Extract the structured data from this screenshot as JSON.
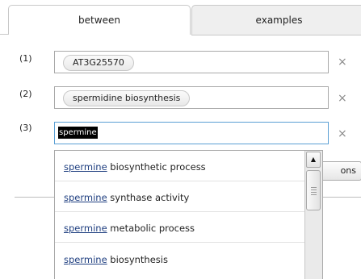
{
  "tabs": [
    {
      "label": "between"
    },
    {
      "label": "examples"
    }
  ],
  "rows": [
    {
      "number": "(1)",
      "chip": "AT3G25570"
    },
    {
      "number": "(2)",
      "chip": "spermidine biosynthesis"
    },
    {
      "number": "(3)",
      "value": "spermine"
    }
  ],
  "clear_glyph": "×",
  "options_button": {
    "label": "ons"
  },
  "dropdown": {
    "items": [
      {
        "match": "spermine",
        "rest": " biosynthetic process"
      },
      {
        "match": "spermine",
        "rest": " synthase activity"
      },
      {
        "match": "spermine",
        "rest": " metabolic process"
      },
      {
        "match": "spermine",
        "rest": " biosynthesis"
      }
    ],
    "scroll_up_glyph": "▲"
  },
  "icons": {
    "clear": "close-icon",
    "scroll_up": "arrow-up-icon",
    "scroll_thumb": "scrollbar-thumb"
  }
}
